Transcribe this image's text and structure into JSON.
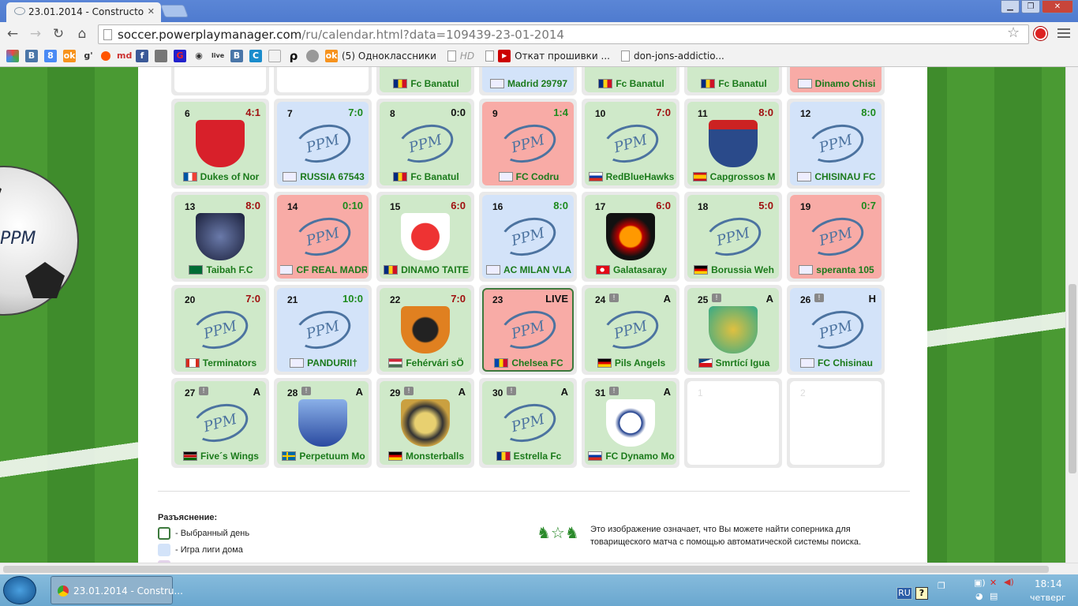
{
  "browser": {
    "tab_title": "23.01.2014 - Constructo",
    "url_host": "soccer.powerplaymanager.com",
    "url_path": "/ru/calendar.html?data=109439-23-01-2014",
    "bookmarks": [
      {
        "label": "(5) Одноклассники"
      },
      {
        "label": "HD"
      },
      {
        "label": "Откат прошивки ..."
      },
      {
        "label": "don-jons-addictio..."
      }
    ]
  },
  "calendar": {
    "partial_row": [
      {
        "day": "",
        "score": "",
        "team": "",
        "type": "e"
      },
      {
        "day": "",
        "score": "",
        "team": "",
        "type": "e"
      },
      {
        "day": "",
        "score": "",
        "team": "Fc Banatul",
        "type": "g",
        "flag": "ro"
      },
      {
        "day": "",
        "score": "",
        "team": "Madrid 29797",
        "type": "b",
        "flag": "ppm"
      },
      {
        "day": "",
        "score": "",
        "team": "Fc Banatul",
        "type": "g",
        "flag": "ro"
      },
      {
        "day": "",
        "score": "",
        "team": "Fc Banatul",
        "type": "g",
        "flag": "ro"
      },
      {
        "day": "",
        "score": "",
        "team": "Dinamo Chisi",
        "type": "r",
        "flag": "ppm"
      }
    ],
    "days": [
      {
        "day": "6",
        "score": "4:1",
        "score_color": "#a01010",
        "team": "Dukes of Nor",
        "type": "g",
        "flag": "fr",
        "logo": "crest-red"
      },
      {
        "day": "7",
        "score": "7:0",
        "score_color": "#1d8a1d",
        "team": "RUSSIA 67543",
        "type": "b",
        "flag": "ppm",
        "logo": "ppm"
      },
      {
        "day": "8",
        "score": "0:0",
        "score_color": "#111111",
        "team": "Fc Banatul",
        "type": "g",
        "flag": "ro",
        "logo": "ppm"
      },
      {
        "day": "9",
        "score": "1:4",
        "score_color": "#1d8a1d",
        "team": "FC Codru",
        "type": "r",
        "flag": "ppm",
        "logo": "ppm"
      },
      {
        "day": "10",
        "score": "7:0",
        "score_color": "#a01010",
        "team": "RedBlueHawks",
        "type": "g",
        "flag": "ru",
        "logo": "ppm"
      },
      {
        "day": "11",
        "score": "8:0",
        "score_color": "#a01010",
        "team": "Capgrossos M",
        "type": "g",
        "flag": "es",
        "logo": "crest-blue"
      },
      {
        "day": "12",
        "score": "8:0",
        "score_color": "#1d8a1d",
        "team": "CHISINAU FC",
        "type": "b",
        "flag": "ppm",
        "logo": "ppm"
      },
      {
        "day": "13",
        "score": "8:0",
        "score_color": "#a01010",
        "team": "Taibah F.C",
        "type": "g",
        "flag": "sa",
        "logo": "crest-navy"
      },
      {
        "day": "14",
        "score": "0:10",
        "score_color": "#1d8a1d",
        "team": "CF REAL MADR",
        "type": "r",
        "flag": "ppm",
        "logo": "ppm"
      },
      {
        "day": "15",
        "score": "6:0",
        "score_color": "#a01010",
        "team": "DINAMO TAITE",
        "type": "g",
        "flag": "ro",
        "logo": "crest-dinamo"
      },
      {
        "day": "16",
        "score": "8:0",
        "score_color": "#1d8a1d",
        "team": "AC MILAN VLA",
        "type": "b",
        "flag": "ppm",
        "logo": "ppm"
      },
      {
        "day": "17",
        "score": "6:0",
        "score_color": "#a01010",
        "team": "Galatasaray",
        "type": "g",
        "flag": "tr",
        "logo": "crest-gala"
      },
      {
        "day": "18",
        "score": "5:0",
        "score_color": "#a01010",
        "team": "Borussia Weh",
        "type": "g",
        "flag": "de",
        "logo": "ppm"
      },
      {
        "day": "19",
        "score": "0:7",
        "score_color": "#1d8a1d",
        "team": "speranta 105",
        "type": "r",
        "flag": "ppm",
        "logo": "ppm"
      },
      {
        "day": "20",
        "score": "7:0",
        "score_color": "#a01010",
        "team": "Terminators",
        "type": "g",
        "flag": "ca",
        "logo": "ppm"
      },
      {
        "day": "21",
        "score": "10:0",
        "score_color": "#1d8a1d",
        "team": "PANDURII†",
        "type": "b",
        "flag": "ppm",
        "logo": "ppm"
      },
      {
        "day": "22",
        "score": "7:0",
        "score_color": "#a01010",
        "team": "Fehérvári sÖ",
        "type": "g",
        "flag": "hu",
        "logo": "crest-orange"
      },
      {
        "day": "23",
        "score": "LIVE",
        "score_color": "#111111",
        "team": "Chelsea FC",
        "type": "r",
        "flag": "md",
        "logo": "ppm",
        "selected": true
      },
      {
        "day": "24",
        "score": "A",
        "score_color": "#111111",
        "team": "Pils Angels",
        "type": "g",
        "flag": "de",
        "logo": "ppm",
        "note": true
      },
      {
        "day": "25",
        "score": "A",
        "score_color": "#111111",
        "team": "Smrtící Igua",
        "type": "g",
        "flag": "cz",
        "logo": "crest-gold",
        "note": true
      },
      {
        "day": "26",
        "score": "H",
        "score_color": "#111111",
        "team": "FC Chisinau",
        "type": "b",
        "flag": "ppm",
        "logo": "ppm",
        "note": true
      },
      {
        "day": "27",
        "score": "A",
        "score_color": "#111111",
        "team": "Five´s Wings",
        "type": "g",
        "flag": "ke",
        "logo": "ppm",
        "note": true
      },
      {
        "day": "28",
        "score": "A",
        "score_color": "#111111",
        "team": "Perpetuum Mo",
        "type": "g",
        "flag": "se",
        "logo": "crest-sky",
        "note": true
      },
      {
        "day": "29",
        "score": "A",
        "score_color": "#111111",
        "team": "Monsterballs",
        "type": "g",
        "flag": "de",
        "logo": "crest-monster",
        "note": true
      },
      {
        "day": "30",
        "score": "A",
        "score_color": "#111111",
        "team": "Estrella Fc",
        "type": "g",
        "flag": "ro",
        "logo": "ppm",
        "note": true
      },
      {
        "day": "31",
        "score": "A",
        "score_color": "#111111",
        "team": "FC Dynamo Mo",
        "type": "g",
        "flag": "ru",
        "logo": "crest-dynamo",
        "note": true
      },
      {
        "day": "1",
        "score": "",
        "team": "",
        "type": "e"
      },
      {
        "day": "2",
        "score": "",
        "team": "",
        "type": "e"
      }
    ],
    "logo_text": "PPM"
  },
  "legend": {
    "title": "Разъяснение:",
    "items": [
      {
        "label": "- Выбранный день"
      },
      {
        "label": "- Игра лиги дома"
      }
    ],
    "explanation_line1": "Это изображение означает, что Вы можете найти соперника для",
    "explanation_line2": "товарищеского матча с помощью автоматической системы поиска."
  },
  "taskbar": {
    "item_label": "23.01.2014 - Constru...",
    "lang": "RU",
    "time": "18:14",
    "weekday": "четверг"
  },
  "colors": {
    "green_cell": "#cfe9c9",
    "blue_cell": "#d3e3f9",
    "red_cell": "#f8aba6",
    "team_text": "#1b7a1b"
  }
}
